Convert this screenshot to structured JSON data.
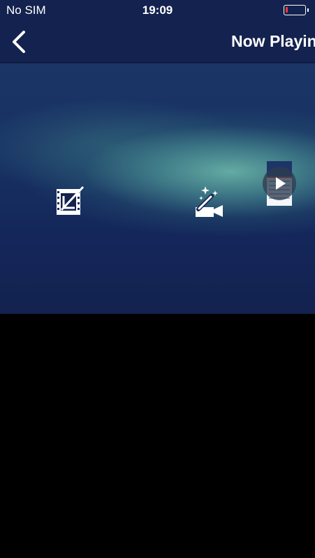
{
  "status_bar": {
    "carrier": "No SIM",
    "time": "19:09",
    "battery_level": 0.1
  },
  "nav": {
    "title": "Now Playing",
    "back_icon": "chevron-left-icon"
  },
  "preview": {
    "play_icon": "play-icon"
  },
  "tools": {
    "crop_icon": "film-crop-icon",
    "effects_icon": "magic-wand-video-icon"
  },
  "colors": {
    "header_background": "#13224e",
    "preview_glow": "#68b2a6",
    "battery_low": "#ff3b30",
    "icon": "#ffffff"
  }
}
